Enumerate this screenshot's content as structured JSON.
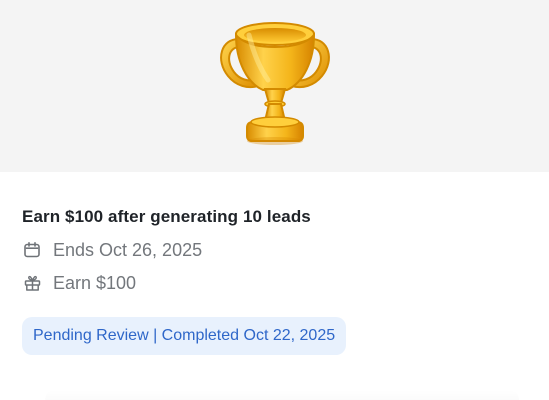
{
  "card": {
    "title": "Earn $100 after generating 10 leads",
    "ends_label": "Ends Oct 26, 2025",
    "reward_label": "Earn $100",
    "status_badge": "Pending Review | Completed Oct 22, 2025"
  },
  "icons": {
    "hero": "trophy-icon",
    "ends": "calendar-icon",
    "reward": "gift-icon"
  },
  "colors": {
    "hero_background": "#f4f4f4",
    "badge_background": "#e8f1fd",
    "badge_text": "#2f67c9",
    "secondary_text": "#73777c",
    "title_text": "#1f2328",
    "trophy_gold": "#f2b51f"
  }
}
